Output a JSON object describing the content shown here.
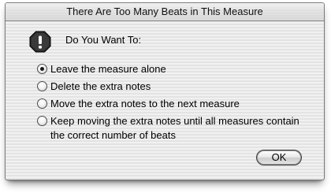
{
  "window": {
    "title": "There Are Too Many Beats in This Measure"
  },
  "dialog": {
    "icon": "stop-alert-icon",
    "heading": "Do You Want To:",
    "options": [
      {
        "label": "Leave the measure alone",
        "selected": true
      },
      {
        "label": "Delete the extra notes",
        "selected": false
      },
      {
        "label": "Move the extra notes to the next measure",
        "selected": false
      },
      {
        "label": "Keep moving the extra notes until all measures contain the correct number of beats",
        "selected": false
      }
    ],
    "ok_label": "OK"
  }
}
